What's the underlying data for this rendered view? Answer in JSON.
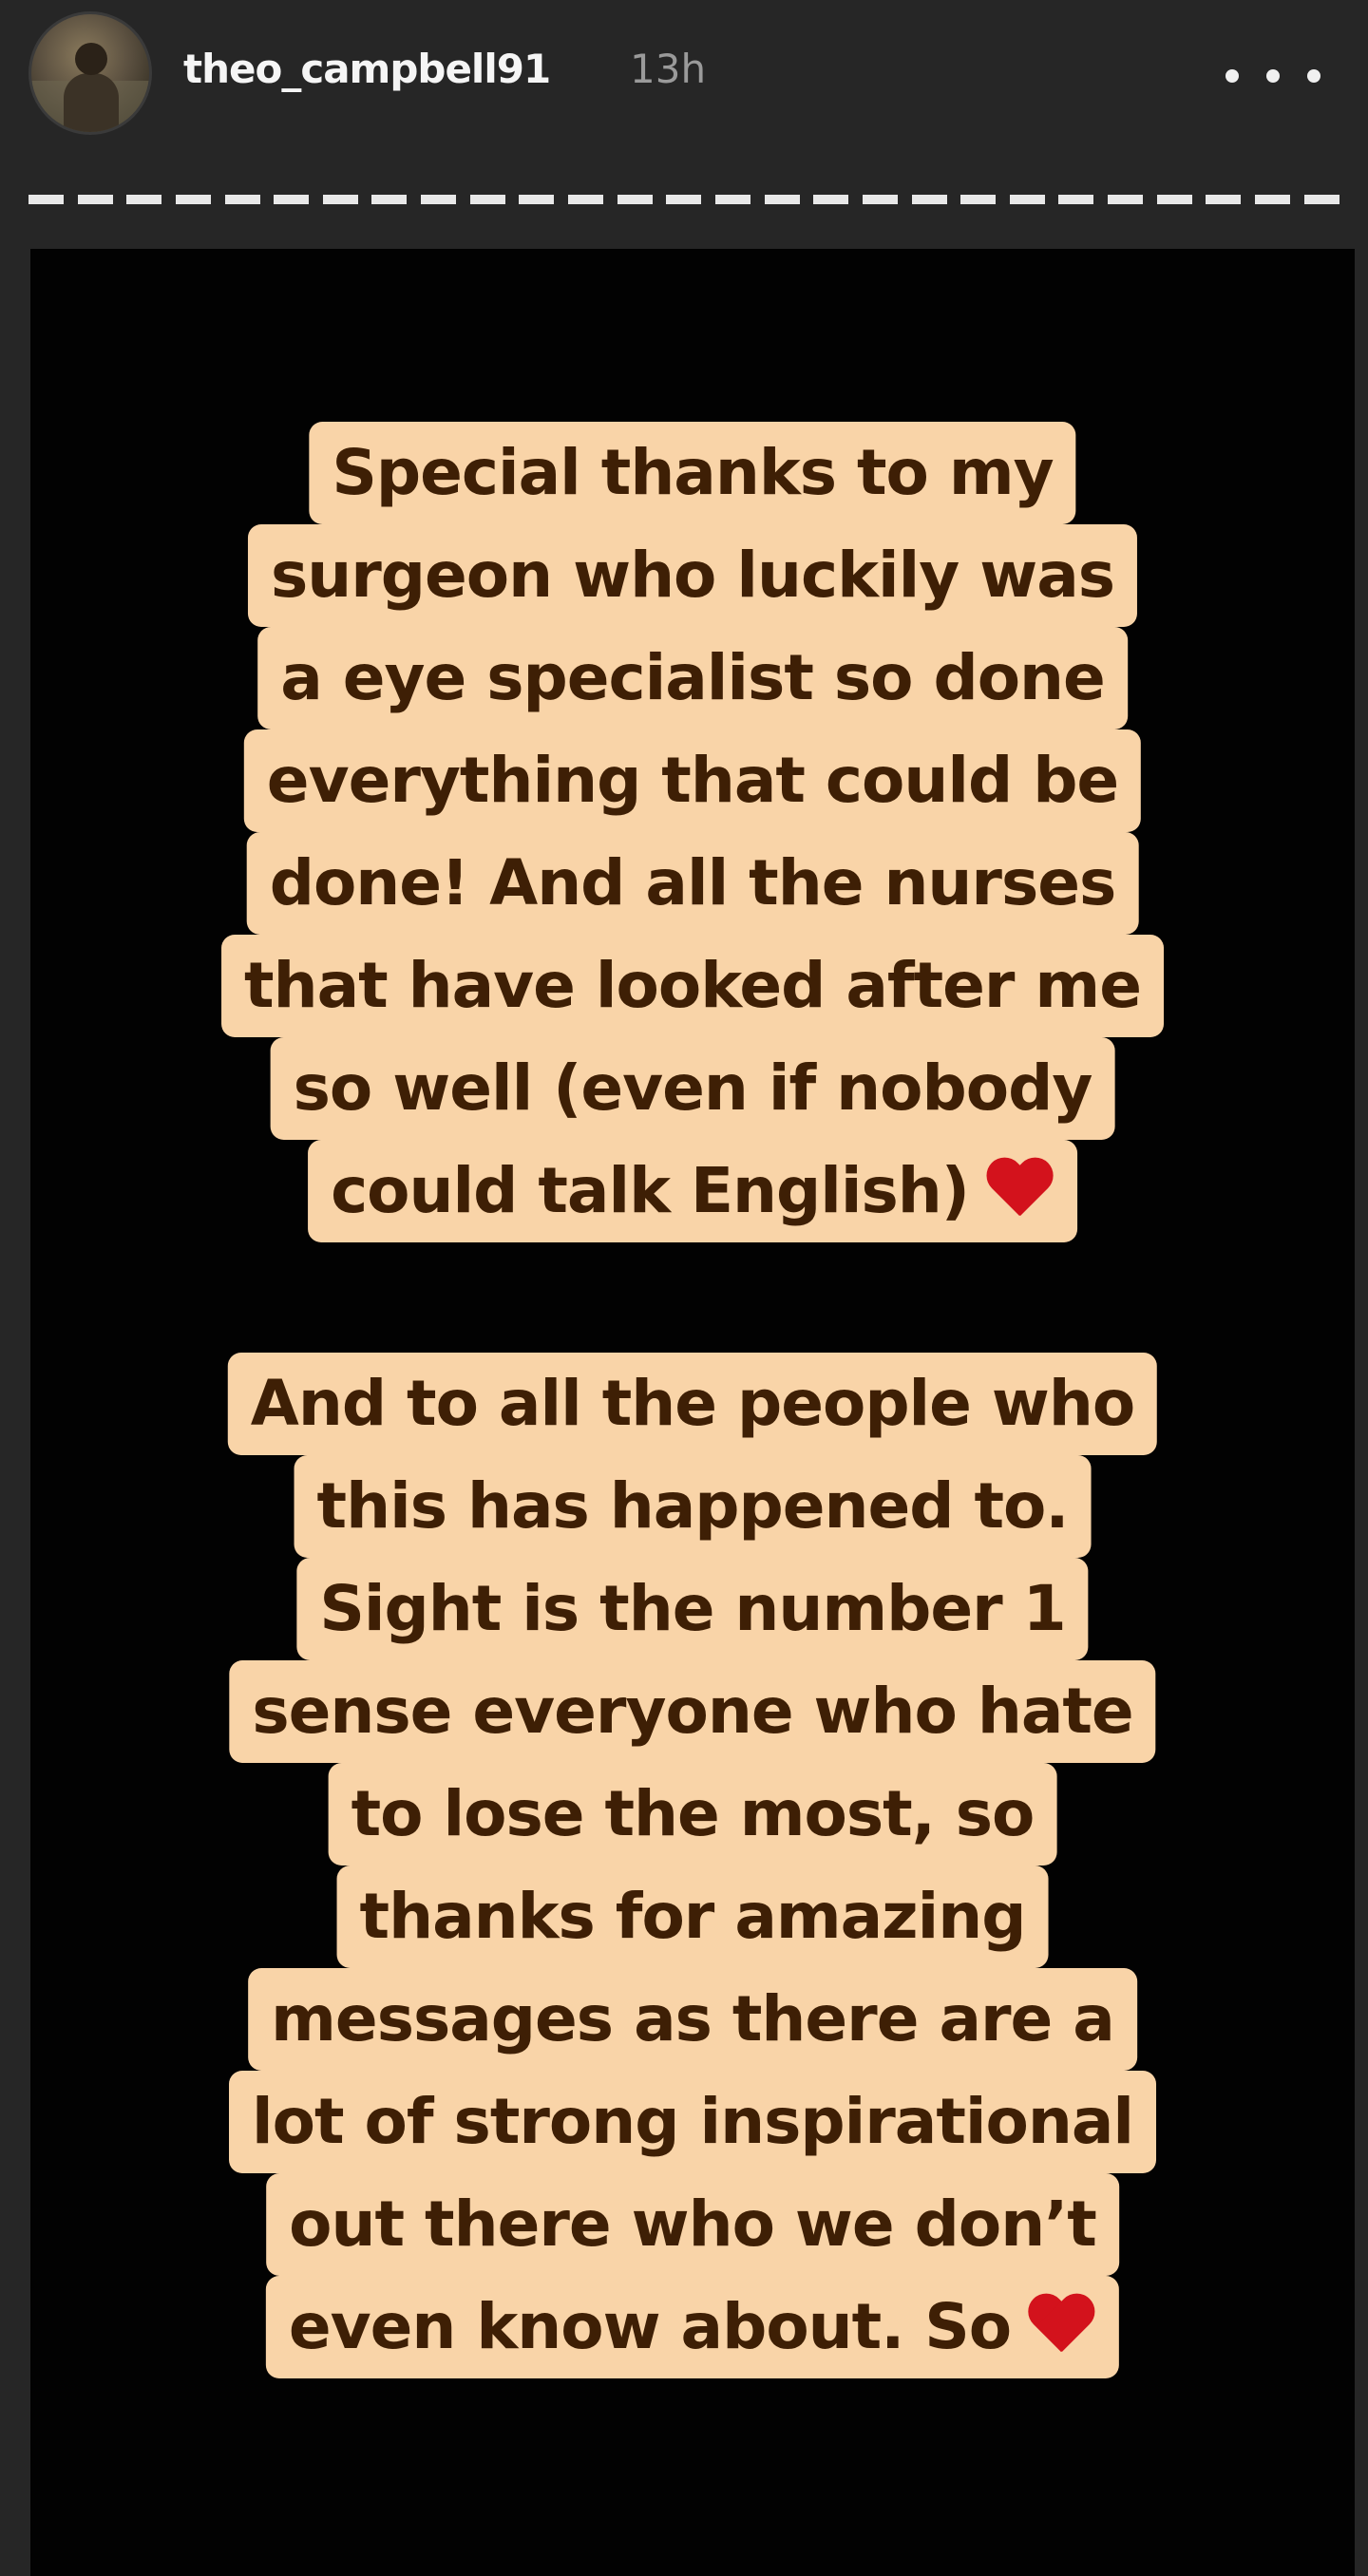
{
  "header": {
    "username": "theo_campbell91",
    "time_ago": "13h",
    "avatar_icon": "user-avatar-icon",
    "more_icon": "more-options-icon"
  },
  "progress": {
    "segments": 27,
    "color": "#e8e8e8"
  },
  "story": {
    "background": "#020202",
    "text_bg": "#f9d4a8",
    "text_color": "#3e1f05",
    "heart_color": "#d3121c",
    "paragraph1": [
      "Special thanks to my",
      "surgeon who luckily was",
      "a eye specialist so done",
      "everything that could be",
      "done! And all the nurses",
      "that have looked after me",
      "so well (even if nobody",
      "could talk English)"
    ],
    "paragraph2": [
      "And to all the people who",
      "this has happened to.",
      "Sight is the number 1",
      "sense everyone who hate",
      "to lose the most, so",
      "thanks for amazing",
      "messages as there are a",
      "lot of strong inspirational",
      "out there who we don’t",
      "even know about.  So"
    ]
  }
}
